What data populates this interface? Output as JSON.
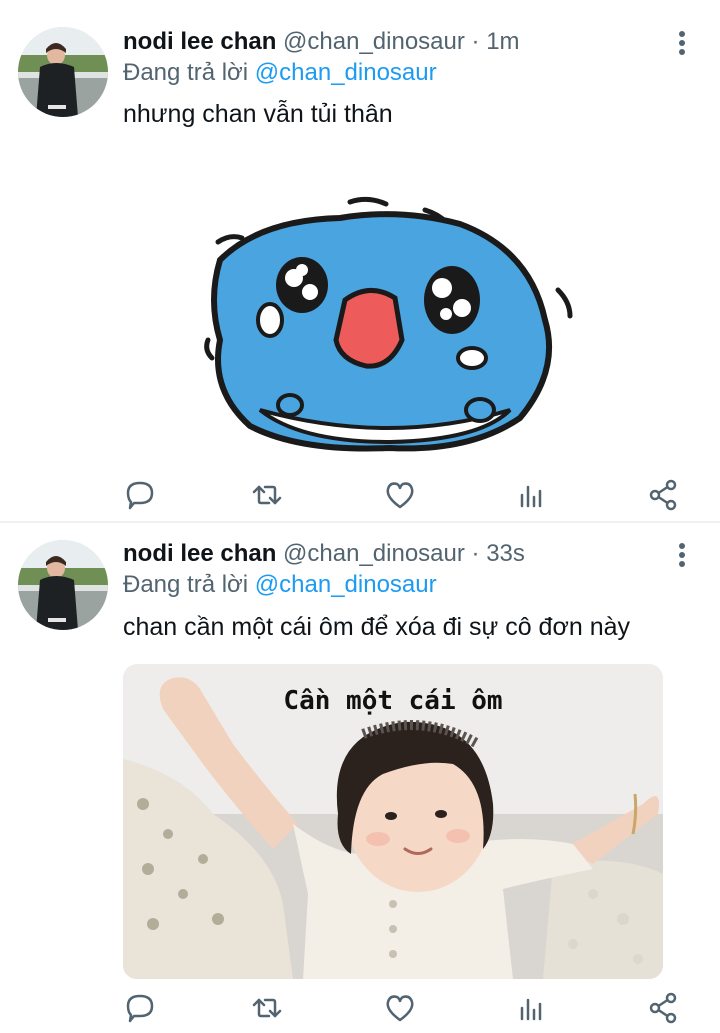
{
  "tweets": [
    {
      "author_name": "nodi lee chan",
      "handle": "@chan_dinosaur",
      "time": "· 1m",
      "reply_prefix": "Đang trả lời",
      "reply_to": "@chan_dinosaur",
      "text": "nhưng chan vẫn tủi thân"
    },
    {
      "author_name": "nodi lee chan",
      "handle": "@chan_dinosaur",
      "time": "· 33s",
      "reply_prefix": "Đang trả lời",
      "reply_to": "@chan_dinosaur",
      "text": "chan cần một cái ôm để xóa đi sự cô đơn này",
      "media_caption": "Cần một cái ôm"
    }
  ],
  "icons": [
    "reply-icon",
    "retweet-icon",
    "like-icon",
    "analytics-icon",
    "share-icon",
    "more-icon"
  ],
  "colors": {
    "accent": "#1d9bf0",
    "text": "#0f1419",
    "secondary": "#536471"
  }
}
